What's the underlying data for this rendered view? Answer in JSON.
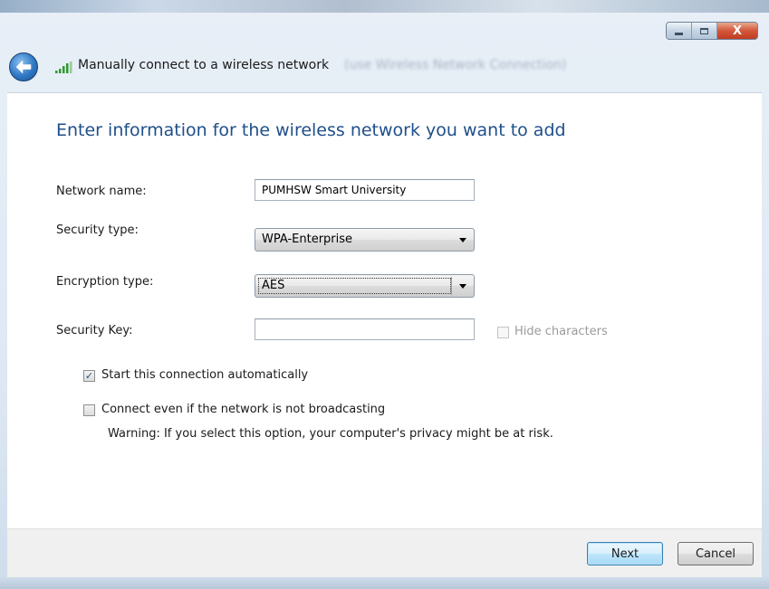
{
  "window": {
    "title": "Manually connect to a wireless network",
    "title_ghost": "(use Wireless Network Connection)",
    "controls": {
      "minimize_icon": "minimize-icon",
      "maximize_icon": "maximize-icon",
      "close_label": "X"
    },
    "back_icon": "back-arrow-icon",
    "signal_icon": "wireless-signal-icon"
  },
  "form": {
    "heading": "Enter information for the wireless network you want to add",
    "network_name": {
      "label": "Network name:",
      "value": "PUMHSW Smart University"
    },
    "security_type": {
      "label": "Security type:",
      "value": "WPA-Enterprise"
    },
    "encryption_type": {
      "label": "Encryption type:",
      "value": "AES"
    },
    "security_key": {
      "label": "Security Key:",
      "value": ""
    },
    "hide_characters": {
      "label": "Hide characters",
      "checked": false,
      "enabled": false
    },
    "start_automatically": {
      "label": "Start this connection automatically",
      "checked": true
    },
    "connect_not_broadcasting": {
      "label": "Connect even if the network is not broadcasting",
      "checked": false
    },
    "warning": "Warning: If you select this option, your computer's privacy might be at risk."
  },
  "footer": {
    "next_label": "Next",
    "cancel_label": "Cancel"
  },
  "colors": {
    "heading": "#1f4f8a",
    "close_button": "#d2573a",
    "default_button": "#bee6fd"
  }
}
